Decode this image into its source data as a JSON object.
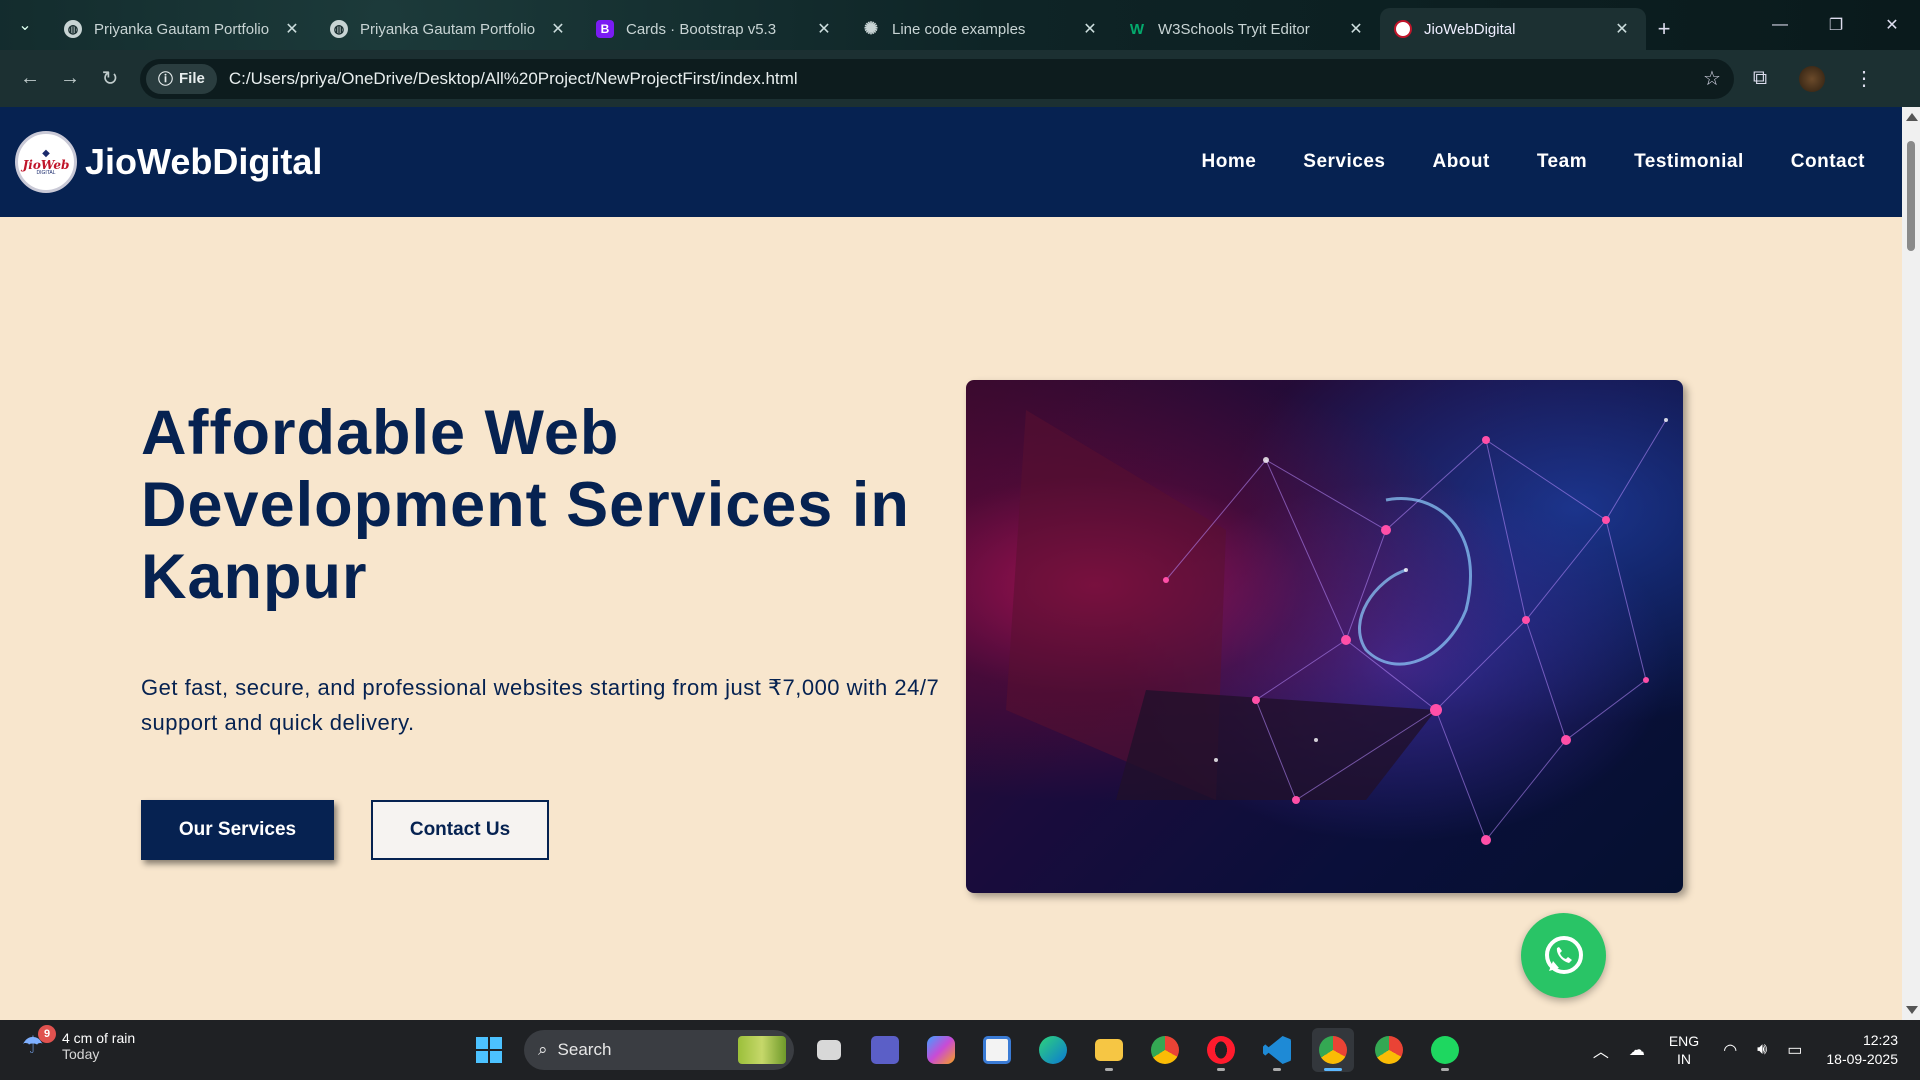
{
  "browser": {
    "tabs": [
      {
        "title": "Priyanka Gautam Portfolio",
        "favicon": "globe-icon",
        "active": false
      },
      {
        "title": "Priyanka Gautam Portfolio",
        "favicon": "globe-icon",
        "active": false
      },
      {
        "title": "Cards · Bootstrap v5.3",
        "favicon": "bootstrap-icon",
        "active": false
      },
      {
        "title": "Line code examples",
        "favicon": "openai-icon",
        "active": false
      },
      {
        "title": "W3Schools Tryit Editor",
        "favicon": "w3schools-icon",
        "active": false
      },
      {
        "title": "JioWebDigital",
        "favicon": "jiowebdigital-icon",
        "active": true
      }
    ],
    "bootstrap_glyph": "B",
    "w3_glyph": "W",
    "site_info_label": "File",
    "url": "C:/Users/priya/OneDrive/Desktop/All%20Project/NewProjectFirst/index.html"
  },
  "site": {
    "brand": "JioWebDigital",
    "logo": {
      "text": "JioWeb",
      "sub": "DIGITAL"
    },
    "nav": [
      "Home",
      "Services",
      "About",
      "Team",
      "Testimonial",
      "Contact"
    ],
    "colors": {
      "primary": "#062251",
      "background": "#f8e6cd",
      "whatsapp": "#29c466"
    }
  },
  "hero": {
    "title": "Affordable Web Development Services in Kanpur",
    "text": "Get fast, secure, and professional websites starting from just ₹7,000 with 24/7 support and quick delivery.",
    "primary_button": "Our Services",
    "secondary_button": "Contact Us"
  },
  "taskbar": {
    "weather": {
      "badge": "9",
      "line1": "4 cm of rain",
      "line2": "Today"
    },
    "search_label": "Search",
    "apps": [
      "file-explorer-icon",
      "teams-icon",
      "copilot-icon",
      "store-icon",
      "edge-icon",
      "folder-icon",
      "chrome-icon",
      "opera-icon",
      "vscode-icon",
      "chrome-icon",
      "chrome-icon",
      "spotify-icon"
    ],
    "language": {
      "line1": "ENG",
      "line2": "IN"
    },
    "clock": {
      "time": "12:23",
      "date": "18-09-2025"
    }
  }
}
